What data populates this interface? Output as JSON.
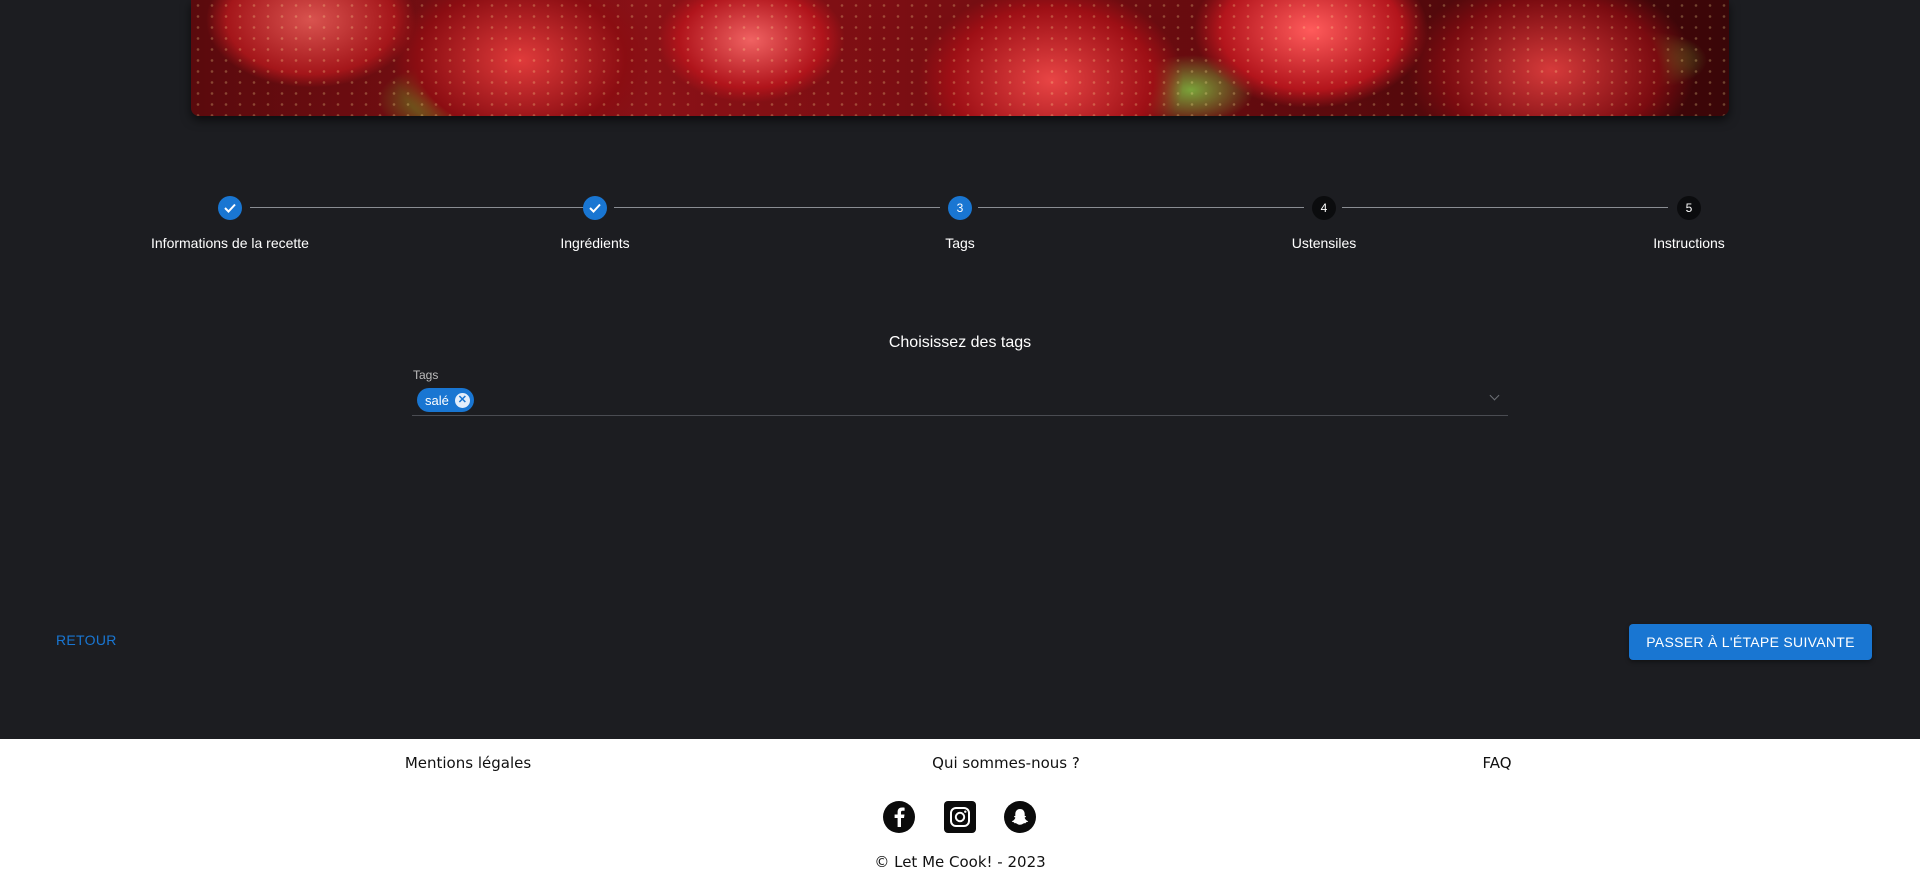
{
  "stepper": {
    "steps": [
      {
        "label": "Informations de la recette",
        "number": "1",
        "status": "done"
      },
      {
        "label": "Ingrédients",
        "number": "2",
        "status": "done"
      },
      {
        "label": "Tags",
        "number": "3",
        "status": "active"
      },
      {
        "label": "Ustensiles",
        "number": "4",
        "status": "todo"
      },
      {
        "label": "Instructions",
        "number": "5",
        "status": "todo"
      }
    ]
  },
  "tags": {
    "title": "Choisissez des tags",
    "field_label": "Tags",
    "selected": [
      "salé"
    ]
  },
  "actions": {
    "back_label": "RETOUR",
    "next_label": "PASSER À L'ÉTAPE SUIVANTE"
  },
  "footer": {
    "links": [
      "Mentions légales",
      "Qui sommes-nous ?",
      "FAQ"
    ],
    "social_icons": [
      "facebook-icon",
      "instagram-icon",
      "snapchat-icon"
    ],
    "copyright": "© Let Me Cook! - 2023"
  },
  "colors": {
    "background": "#1c1d21",
    "accent": "#1976d2",
    "footer_background": "#ffffff"
  }
}
